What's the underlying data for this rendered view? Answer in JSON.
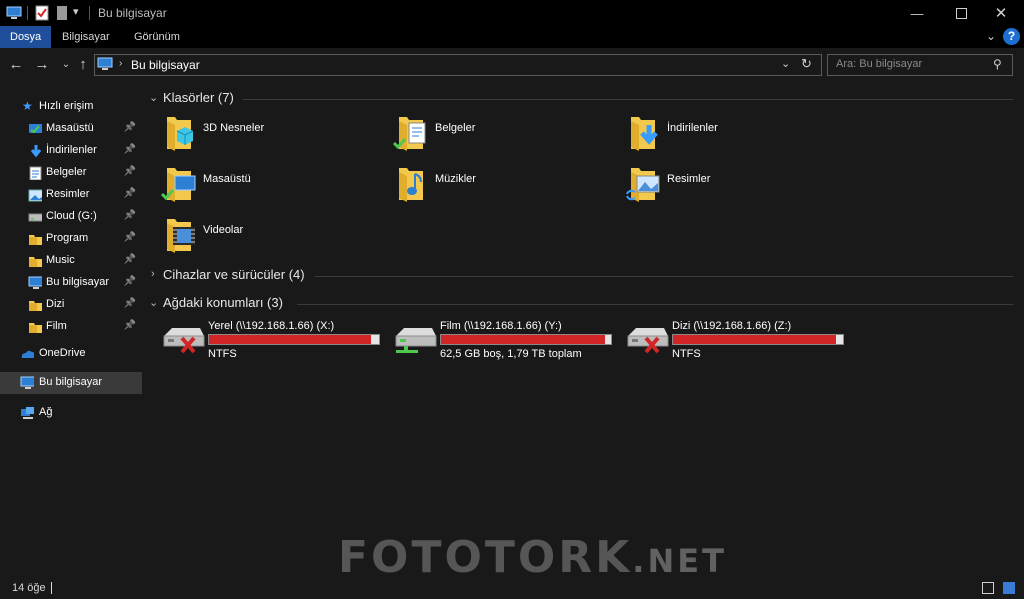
{
  "window": {
    "title": "Bu bilgisayar",
    "controls": [
      "minimize-icon",
      "maximize-icon",
      "close-icon"
    ]
  },
  "ribbon": {
    "tabs": [
      {
        "label": "Dosya",
        "active": true
      },
      {
        "label": "Bilgisayar",
        "active": false
      },
      {
        "label": "Görünüm",
        "active": false
      }
    ],
    "help": "?"
  },
  "navbar": {
    "address": "Bu bilgisayar",
    "search_placeholder": "Ara: Bu bilgisayar"
  },
  "sidebar": {
    "quick_access": "Hızlı erişim",
    "items": [
      {
        "label": "Masaüstü",
        "icon": "desktop-icon",
        "pinned": true
      },
      {
        "label": "İndirilenler",
        "icon": "downloads-icon",
        "pinned": true
      },
      {
        "label": "Belgeler",
        "icon": "documents-icon",
        "pinned": true
      },
      {
        "label": "Resimler",
        "icon": "pictures-icon",
        "pinned": true
      },
      {
        "label": "Cloud (G:)",
        "icon": "drive-icon",
        "pinned": true
      },
      {
        "label": "Program",
        "icon": "folder-icon",
        "pinned": true
      },
      {
        "label": "Music",
        "icon": "folder-icon",
        "pinned": true
      },
      {
        "label": "Bu bilgisayar",
        "icon": "computer-icon",
        "pinned": true
      },
      {
        "label": "Dizi",
        "icon": "folder-icon",
        "pinned": true
      },
      {
        "label": "Film",
        "icon": "folder-icon",
        "pinned": true
      }
    ],
    "onedrive": "OneDrive",
    "this_pc": "Bu bilgisayar",
    "network": "Ağ"
  },
  "content": {
    "folders_header": "Klasörler (7)",
    "folders": [
      {
        "label": "3D Nesneler",
        "icon": "3d-objects-folder-icon"
      },
      {
        "label": "Belgeler",
        "icon": "documents-folder-icon"
      },
      {
        "label": "İndirilenler",
        "icon": "downloads-folder-icon"
      },
      {
        "label": "Masaüstü",
        "icon": "desktop-folder-icon"
      },
      {
        "label": "Müzikler",
        "icon": "music-folder-icon"
      },
      {
        "label": "Resimler",
        "icon": "pictures-folder-icon"
      },
      {
        "label": "Videolar",
        "icon": "videos-folder-icon"
      }
    ],
    "devices_header": "Cihazlar ve sürücüler (4)",
    "network_header": "Ağdaki konumları (3)",
    "drives": [
      {
        "label": "Yerel (\\\\192.168.1.66) (X:)",
        "sub": "NTFS",
        "connected": false,
        "used_fraction": 0.95
      },
      {
        "label": "Film (\\\\192.168.1.66) (Y:)",
        "sub": "62,5 GB boş, 1,79 TB toplam",
        "connected": true,
        "used_fraction": 0.966
      },
      {
        "label": "Dizi (\\\\192.168.1.66) (Z:)",
        "sub": "NTFS",
        "connected": false,
        "used_fraction": 0.96
      }
    ]
  },
  "statusbar": {
    "count": "14 öğe"
  },
  "watermark": {
    "main": "FOTOTORK",
    "tld": ".NET"
  },
  "colors": {
    "background": "#191919",
    "ribbon_active": "#1f4e9a",
    "folder_yellow": "#f2c94c",
    "drive_bar": "#d22525",
    "accent_blue": "#1c6fd1"
  }
}
